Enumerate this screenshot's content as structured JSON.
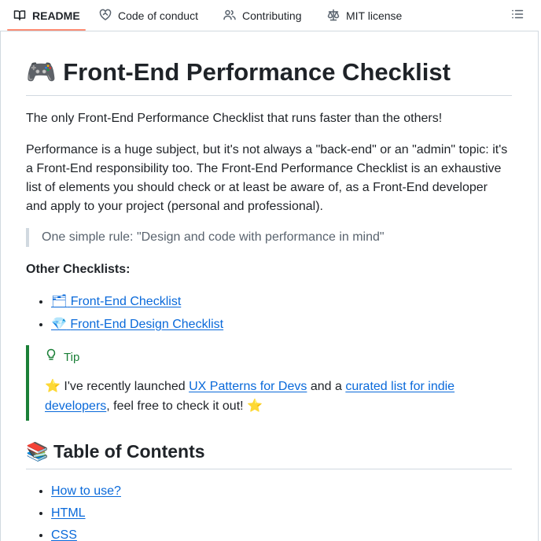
{
  "tabs": [
    {
      "label": "README",
      "icon": "book-icon",
      "active": true
    },
    {
      "label": "Code of conduct",
      "icon": "heart-handshake-icon",
      "active": false
    },
    {
      "label": "Contributing",
      "icon": "people-icon",
      "active": false
    },
    {
      "label": "MIT license",
      "icon": "scale-icon",
      "active": false
    }
  ],
  "accent_color": "#fd8c73",
  "link_color": "#0969da",
  "tip_color": "#1a7f37",
  "title": {
    "emoji": "🎮",
    "text": "Front-End Performance Checklist"
  },
  "intro": "The only Front-End Performance Checklist that runs faster than the others!",
  "description": "Performance is a huge subject, but it's not always a \"back-end\" or an \"admin\" topic: it's a Front-End responsibility too. The Front-End Performance Checklist is an exhaustive list of elements you should check or at least be aware of, as a Front-End developer and apply to your project (personal and professional).",
  "quote": "One simple rule: \"Design and code with performance in mind\"",
  "other_heading": "Other Checklists:",
  "other_links": [
    {
      "emoji": "🗂",
      "label": "Front-End Checklist"
    },
    {
      "emoji": "💎",
      "label": "Front-End Design Checklist"
    }
  ],
  "tip": {
    "title": "Tip",
    "star": "⭐",
    "text_before": "I've recently launched",
    "link1": "UX Patterns for Devs",
    "text_mid": "and a",
    "link2": "curated list for indie developers",
    "text_after": ", feel free to check it out!"
  },
  "toc": {
    "emoji": "📚",
    "heading": "Table of Contents",
    "items": [
      "How to use?",
      "HTML",
      "CSS"
    ]
  }
}
